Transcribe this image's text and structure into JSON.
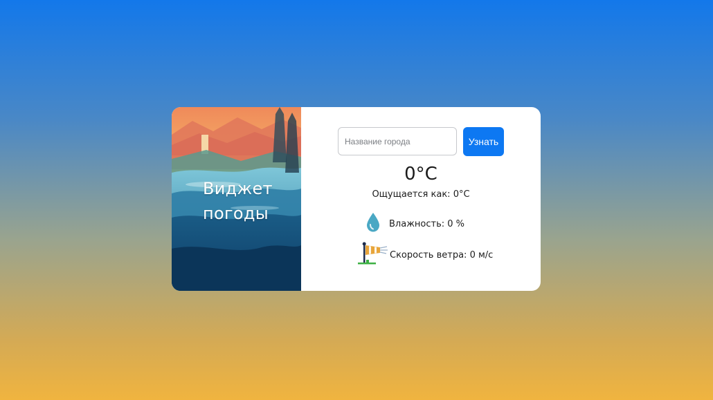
{
  "widget": {
    "banner": {
      "title_line1": "Виджет",
      "title_line2": "погоды"
    },
    "search": {
      "placeholder": "Название города",
      "value": "",
      "button_label": "Узнать"
    },
    "weather": {
      "temperature": "0°C",
      "feels_like": "Ощущается как: 0°C",
      "humidity": "Влажность: 0 %",
      "wind_speed": "Скорость ветра: 0 м/с"
    },
    "icons": {
      "humidity": "water-drop-icon",
      "wind": "windsock-icon"
    },
    "colors": {
      "accent": "#0d78f2",
      "background_top": "#1378ea",
      "background_bottom": "#f0b43f"
    }
  }
}
